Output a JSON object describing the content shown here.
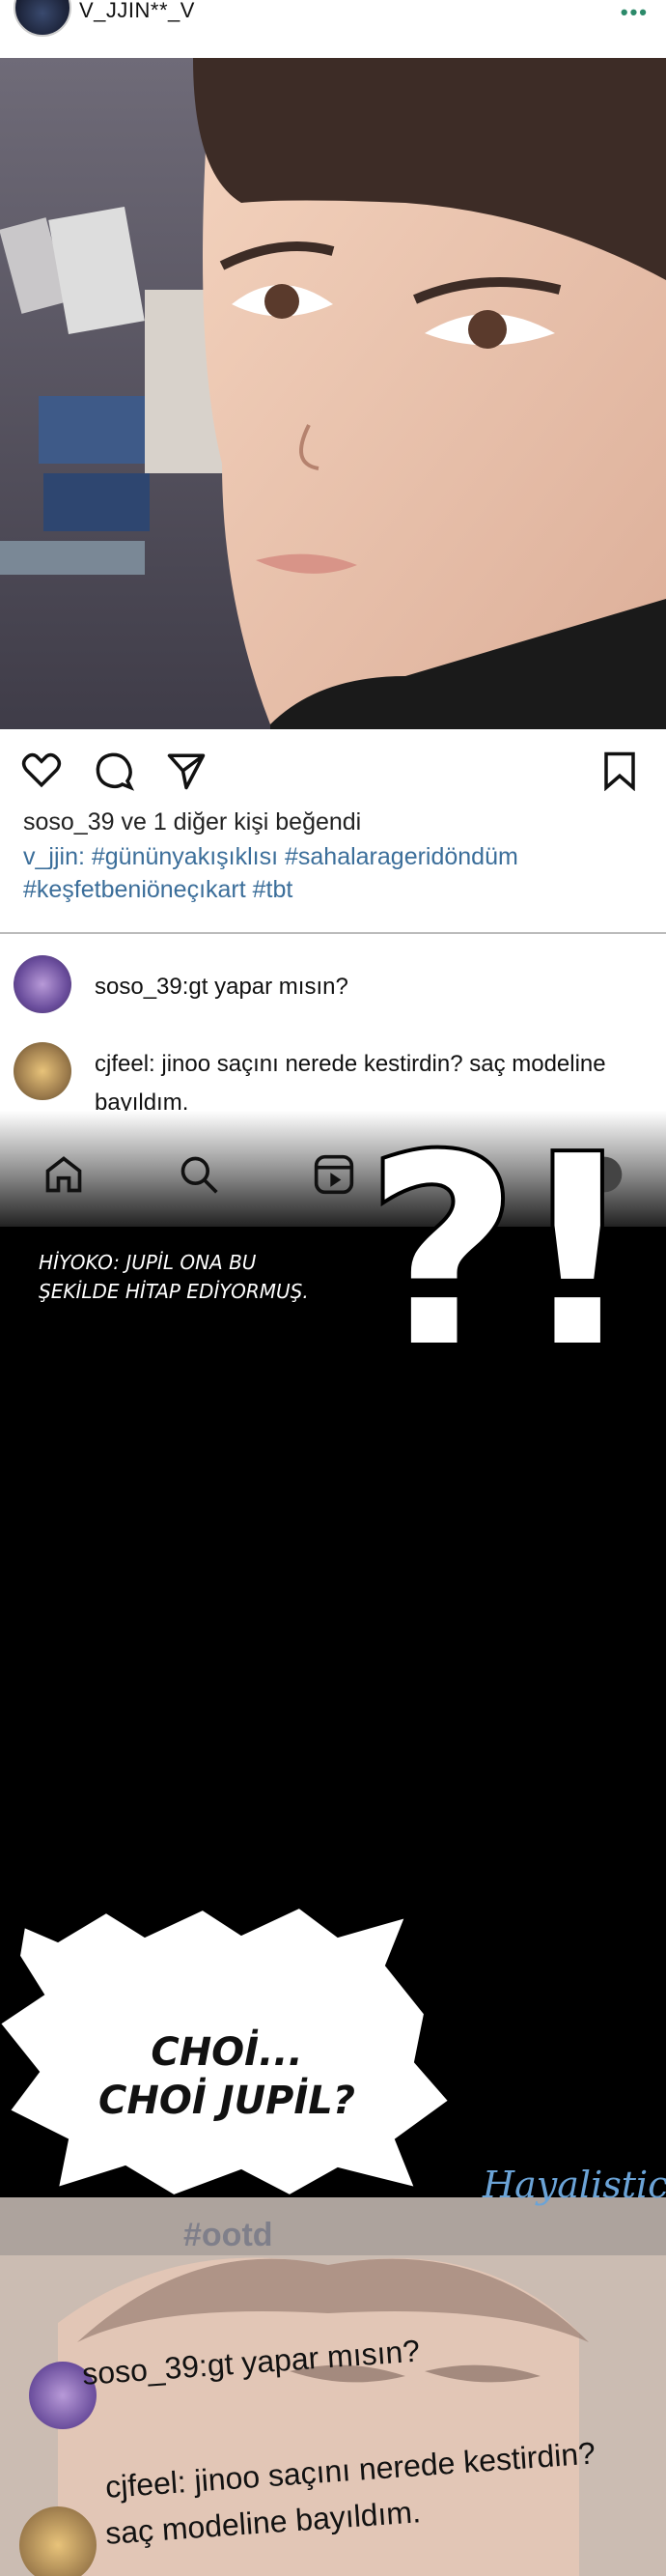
{
  "header": {
    "username": "V_JJIN**_V",
    "more_label": "•••"
  },
  "actions": {
    "likes_text": "soso_39 ve 1 diğer kişi beğendi",
    "caption_user": "v_jjin:",
    "caption_tags_line1": "#gününyakışıklısı #sahalarageridöndüm",
    "caption_tags_line2": "#keşfetbeniöneçıkart #tbt"
  },
  "comments": [
    {
      "text": "soso_39:gt yapar mısın?"
    },
    {
      "text_line1": "cjfeel: jinoo saçını nerede kestirdin? saç modeline",
      "text_line2": "bayıldım."
    }
  ],
  "overlay": {
    "punctuation": "?!",
    "note_line1": "HİYOKO: JUPİL ONA BU",
    "note_line2": "ŞEKİLDE HİTAP EDİYORMUŞ.",
    "bubble_line1": "CHOİ...",
    "bubble_line2": "CHOİ JUPİL?"
  },
  "bottom_panel": {
    "hashtag": "#ootd",
    "comment1": "soso_39:gt yapar mısın?",
    "comment2_line1": "cjfeel: jinoo saçını nerede kestirdin?",
    "comment2_line2": "saç modeline bayıldım.",
    "watermark": "Hayalistic"
  }
}
